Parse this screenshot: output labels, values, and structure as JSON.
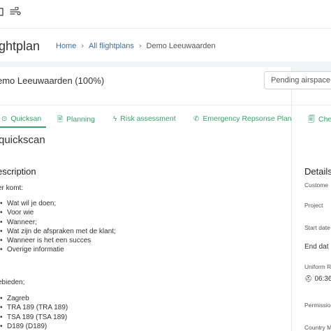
{
  "topbar": {
    "left_icon": "menu-icon",
    "right_icon": "wind-icon"
  },
  "header": {
    "title": "ightplan",
    "breadcrumb": {
      "home": "Home",
      "all": "All flightplans",
      "current": "Demo Leeuwaarden",
      "separator": "›"
    }
  },
  "flightplan": {
    "title": "emo Leeuwaarden (100%)",
    "status_button": "Pending airspace request"
  },
  "tabs": [
    {
      "label": "Quicksan",
      "icon": "clock-icon",
      "glyph": "⊙"
    },
    {
      "label": "Planning",
      "icon": "file-icon",
      "glyph": "🗎"
    },
    {
      "label": "Risk assessment",
      "icon": "lightning-icon",
      "glyph": "ϟ"
    },
    {
      "label": "Emergency Repsonse Plan",
      "icon": "phone-icon",
      "glyph": "✆"
    },
    {
      "label": "Che",
      "icon": "clipboard-icon",
      "glyph": "🗐"
    }
  ],
  "colors": {
    "accent_green": "#3aa36b",
    "link_blue": "#3d6fa5"
  },
  "main": {
    "section_title": "quickscan",
    "description_heading": "escription",
    "intro": "er komt:",
    "questions": [
      "Wat wil je doen;",
      "Voor wie",
      "Wanneer;",
      "Wat zijn de afspraken met de klant;",
      "Wanneer is het een succes",
      "Overige informatie"
    ],
    "areas_label": "ebieden;",
    "areas": [
      "Zagreb",
      "TRA 189 (TRA 189)",
      "TSA 189 (TSA 189)",
      "D189 (D189)"
    ]
  },
  "details": {
    "heading": "Details",
    "customer_label": "Custome",
    "project_label": "Project",
    "start_label": "Start date",
    "end_label": "End dat",
    "uniform_label": "Uniform R",
    "uniform_value": "06:36",
    "permission_label": "Permissio",
    "country_label": "Country M"
  }
}
